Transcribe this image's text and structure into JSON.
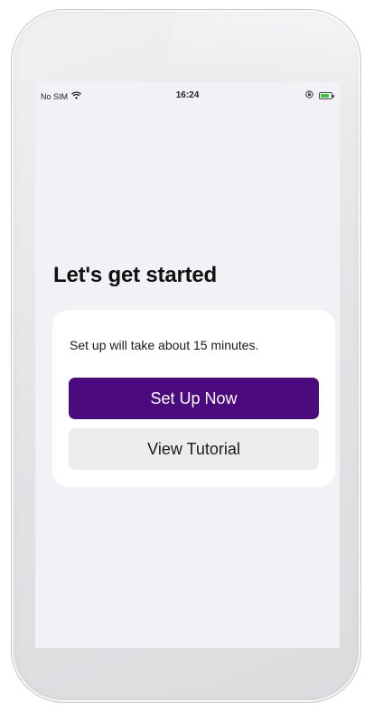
{
  "status_bar": {
    "carrier": "No SIM",
    "time": "16:24",
    "wifi_icon": "wifi-icon",
    "orientation_lock_icon": "orientation-lock-icon",
    "battery_icon": "battery-charging-icon"
  },
  "onboarding": {
    "title": "Let's get started",
    "description": "Set up will take about 15 minutes.",
    "primary_button": "Set Up Now",
    "secondary_button": "View Tutorial"
  },
  "colors": {
    "primary_button_bg": "#4b0a7d",
    "secondary_button_bg": "#ececee",
    "screen_bg": "#f2f1f6",
    "battery_fill": "#36c43b"
  }
}
